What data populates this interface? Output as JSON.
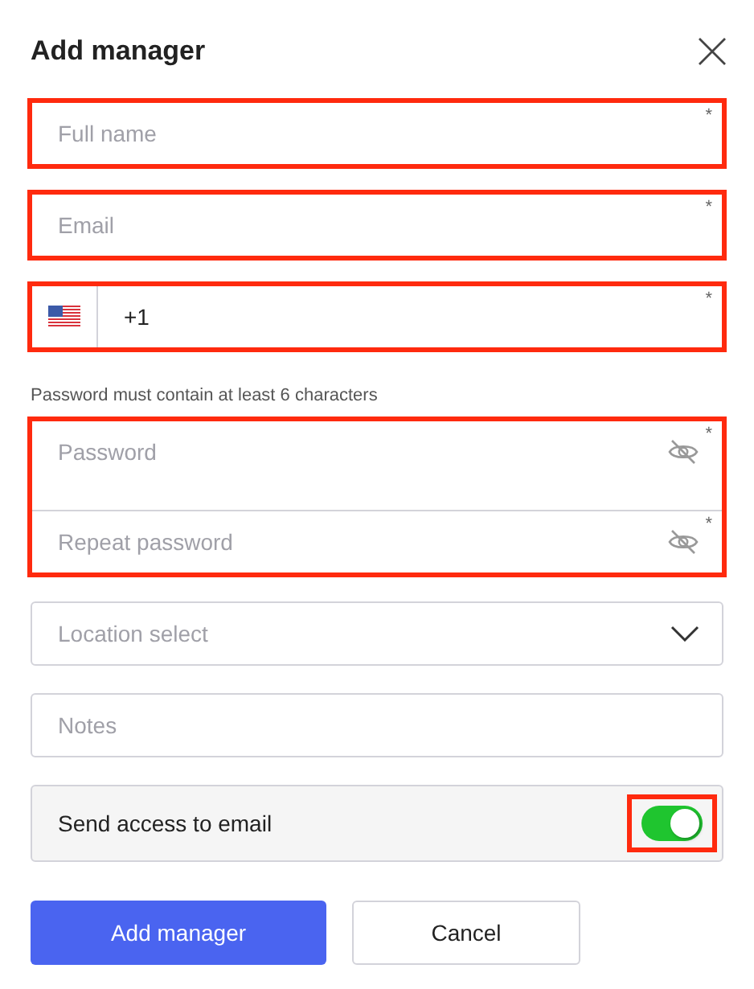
{
  "dialog": {
    "title": "Add manager"
  },
  "fields": [
    {
      "kind": "text",
      "placeholder": "Full name",
      "required_mark": "*",
      "highlighted": true
    },
    {
      "kind": "text",
      "placeholder": "Email",
      "required_mark": "*",
      "highlighted": true
    },
    {
      "kind": "phone",
      "value": "+1",
      "required_mark": "*",
      "highlighted": true
    },
    {
      "kind": "hint",
      "text": "Password must contain at least 6 characters"
    },
    {
      "kind": "password_group",
      "highlighted": true,
      "items": [
        {
          "placeholder": "Password",
          "required_mark": "*"
        },
        {
          "placeholder": "Repeat password",
          "required_mark": "*"
        }
      ]
    },
    {
      "kind": "select",
      "placeholder": "Location select",
      "highlighted": false
    },
    {
      "kind": "text",
      "placeholder": "Notes",
      "highlighted": false
    },
    {
      "kind": "toggle",
      "label": "Send access to email",
      "on": true,
      "highlighted": true
    }
  ],
  "buttons": [
    {
      "label": "Add manager",
      "kind": "primary"
    },
    {
      "label": "Cancel",
      "kind": "secondary"
    }
  ]
}
